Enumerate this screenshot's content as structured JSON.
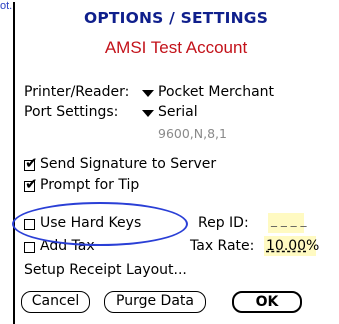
{
  "fragment": "ot.",
  "header": {
    "title": "OPTIONS / SETTINGS",
    "account": "AMSI Test Account"
  },
  "printer": {
    "label": "Printer/Reader:",
    "value": "Pocket Merchant"
  },
  "port": {
    "label": "Port Settings:",
    "value": "Serial",
    "detail": "9600,N,8,1"
  },
  "checkboxes": {
    "send_signature": {
      "label": "Send Signature to Server",
      "checked": true
    },
    "prompt_tip": {
      "label": "Prompt for Tip",
      "checked": true
    },
    "hard_keys": {
      "label": "Use Hard Keys",
      "checked": false
    },
    "add_tax": {
      "label": "Add Tax",
      "checked": false
    }
  },
  "rep": {
    "label": "Rep ID:",
    "value": "_ _ _ _"
  },
  "tax": {
    "label": "Tax Rate:",
    "value": "10.00",
    "unit": "%"
  },
  "setup_receipt": "Setup Receipt Layout...",
  "buttons": {
    "cancel": "Cancel",
    "purge": "Purge Data",
    "ok": "OK"
  },
  "annotation_color": "#2a3fd6"
}
